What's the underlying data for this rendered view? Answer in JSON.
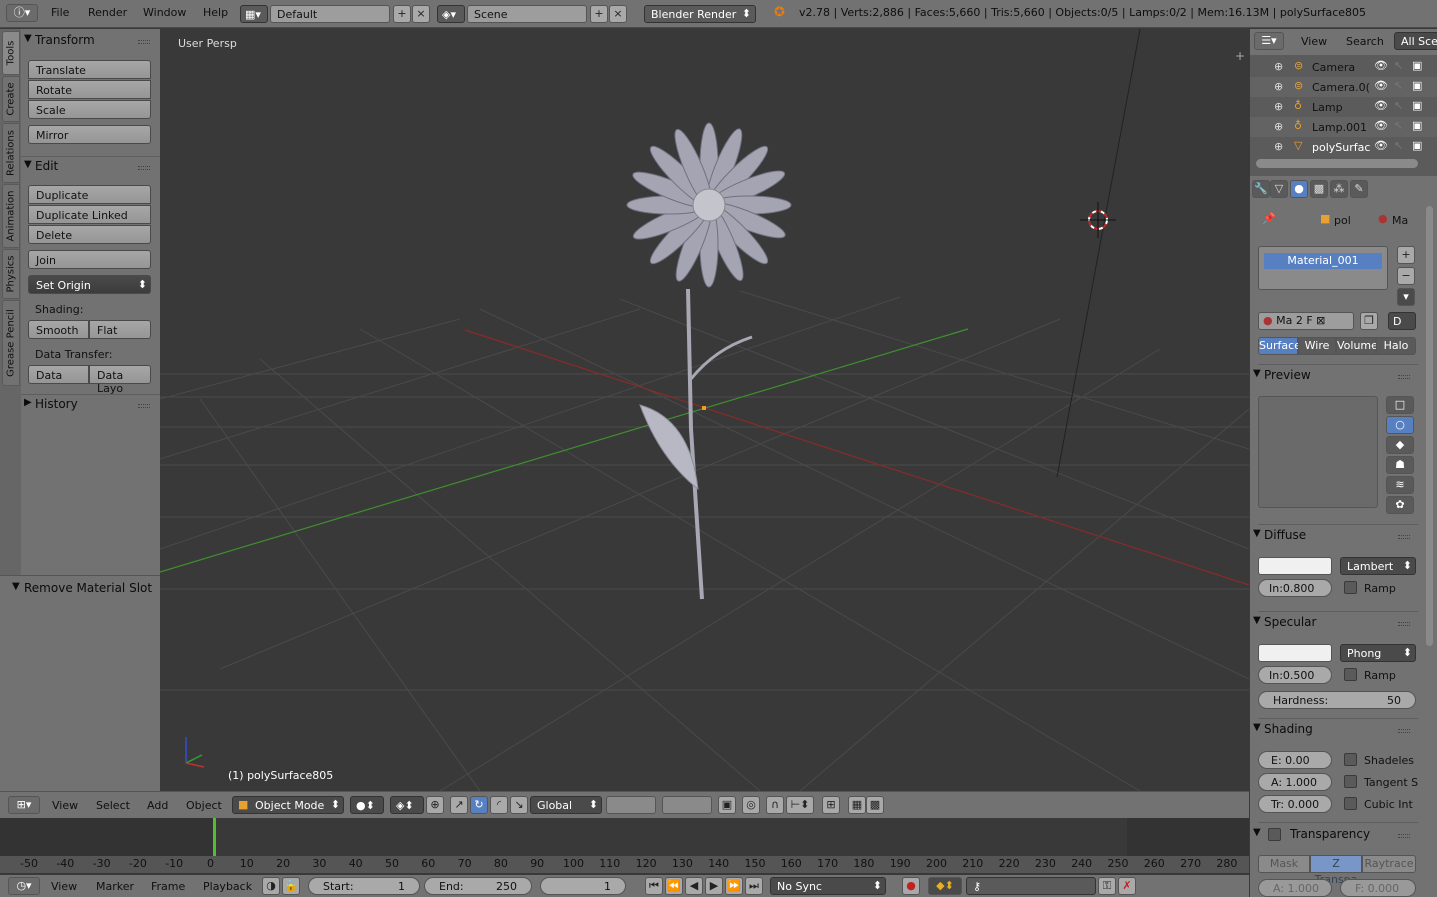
{
  "topbar": {
    "menus": [
      "File",
      "Render",
      "Window",
      "Help"
    ],
    "layout": "Default",
    "scene": "Scene",
    "engine": "Blender Render",
    "stats": "v2.78 | Verts:2,886 | Faces:5,660 | Tris:5,660 | Objects:0/5 | Lamps:0/2 | Mem:16.13M | polySurface805"
  },
  "tabs": [
    "Tools",
    "Create",
    "Relations",
    "Animation",
    "Physics",
    "Grease Pencil"
  ],
  "toolshelf": {
    "transform_title": "Transform",
    "translate": "Translate",
    "rotate": "Rotate",
    "scale": "Scale",
    "mirror": "Mirror",
    "edit_title": "Edit",
    "duplicate": "Duplicate",
    "duplicate_linked": "Duplicate Linked",
    "delete": "Delete",
    "join": "Join",
    "set_origin": "Set Origin",
    "shading_label": "Shading:",
    "smooth": "Smooth",
    "flat": "Flat",
    "data_transfer_label": "Data Transfer:",
    "data": "Data",
    "data_layout": "Data Layo",
    "history_title": "History"
  },
  "redo_panel": {
    "title": "Remove Material Slot"
  },
  "viewport": {
    "label": "User Persp",
    "object_label": "(1) polySurface805"
  },
  "view3d_header": {
    "view": "View",
    "select": "Select",
    "add": "Add",
    "object": "Object",
    "mode": "Object Mode",
    "orientation": "Global"
  },
  "timeline": {
    "ticks": [
      "-50",
      "-40",
      "-30",
      "-20",
      "-10",
      "0",
      "10",
      "20",
      "30",
      "40",
      "50",
      "60",
      "70",
      "80",
      "90",
      "100",
      "110",
      "120",
      "130",
      "140",
      "150",
      "160",
      "170",
      "180",
      "190",
      "200",
      "210",
      "220",
      "230",
      "240",
      "250",
      "260",
      "270",
      "280"
    ],
    "current_frame_marker": 0,
    "menus": [
      "View",
      "Marker",
      "Frame",
      "Playback"
    ],
    "start_label": "Start:",
    "start": "1",
    "end_label": "End:",
    "end": "250",
    "current": "1",
    "sync": "No Sync"
  },
  "outliner": {
    "view": "View",
    "search": "Search",
    "filter": "All Sce",
    "items": [
      {
        "name": "Camera",
        "icon": "camera-icon"
      },
      {
        "name": "Camera.0(",
        "icon": "camera-icon"
      },
      {
        "name": "Lamp",
        "icon": "lamp-icon"
      },
      {
        "name": "Lamp.001",
        "icon": "lamp-icon"
      },
      {
        "name": "polySurfac",
        "icon": "mesh-icon"
      }
    ]
  },
  "properties": {
    "breadcrumb_obj": "pol",
    "breadcrumb_mat": "Ma",
    "material_slot": "Material_001",
    "mat_field": "Ma",
    "users": "2",
    "fake": "F",
    "data_btn": "D",
    "tabs": [
      "Surface",
      "Wire",
      "Volume",
      "Halo"
    ],
    "preview_title": "Preview",
    "diffuse_title": "Diffuse",
    "diffuse_shader": "Lambert",
    "diffuse_intensity": "In:0.800",
    "ramp": "Ramp",
    "specular_title": "Specular",
    "specular_shader": "Phong",
    "specular_intensity": "In:0.500",
    "hardness_label": "Hardness:",
    "hardness": "50",
    "shading_title": "Shading",
    "emit": "E:  0.00",
    "ambient": "A: 1.000",
    "translucency": "Tr: 0.000",
    "shadeless": "Shadeles",
    "tangent": "Tangent S",
    "cubic": "Cubic Int",
    "transparency_title": "Transparency",
    "mask": "Mask",
    "ztransp": "Z Transpa",
    "raytrace": "Raytrace",
    "alpha": "A: 1.000",
    "fresnel": "F: 0.000"
  },
  "colors": {
    "active_blue": "#5680c2",
    "header": "#727272",
    "viewport": "#393939"
  }
}
